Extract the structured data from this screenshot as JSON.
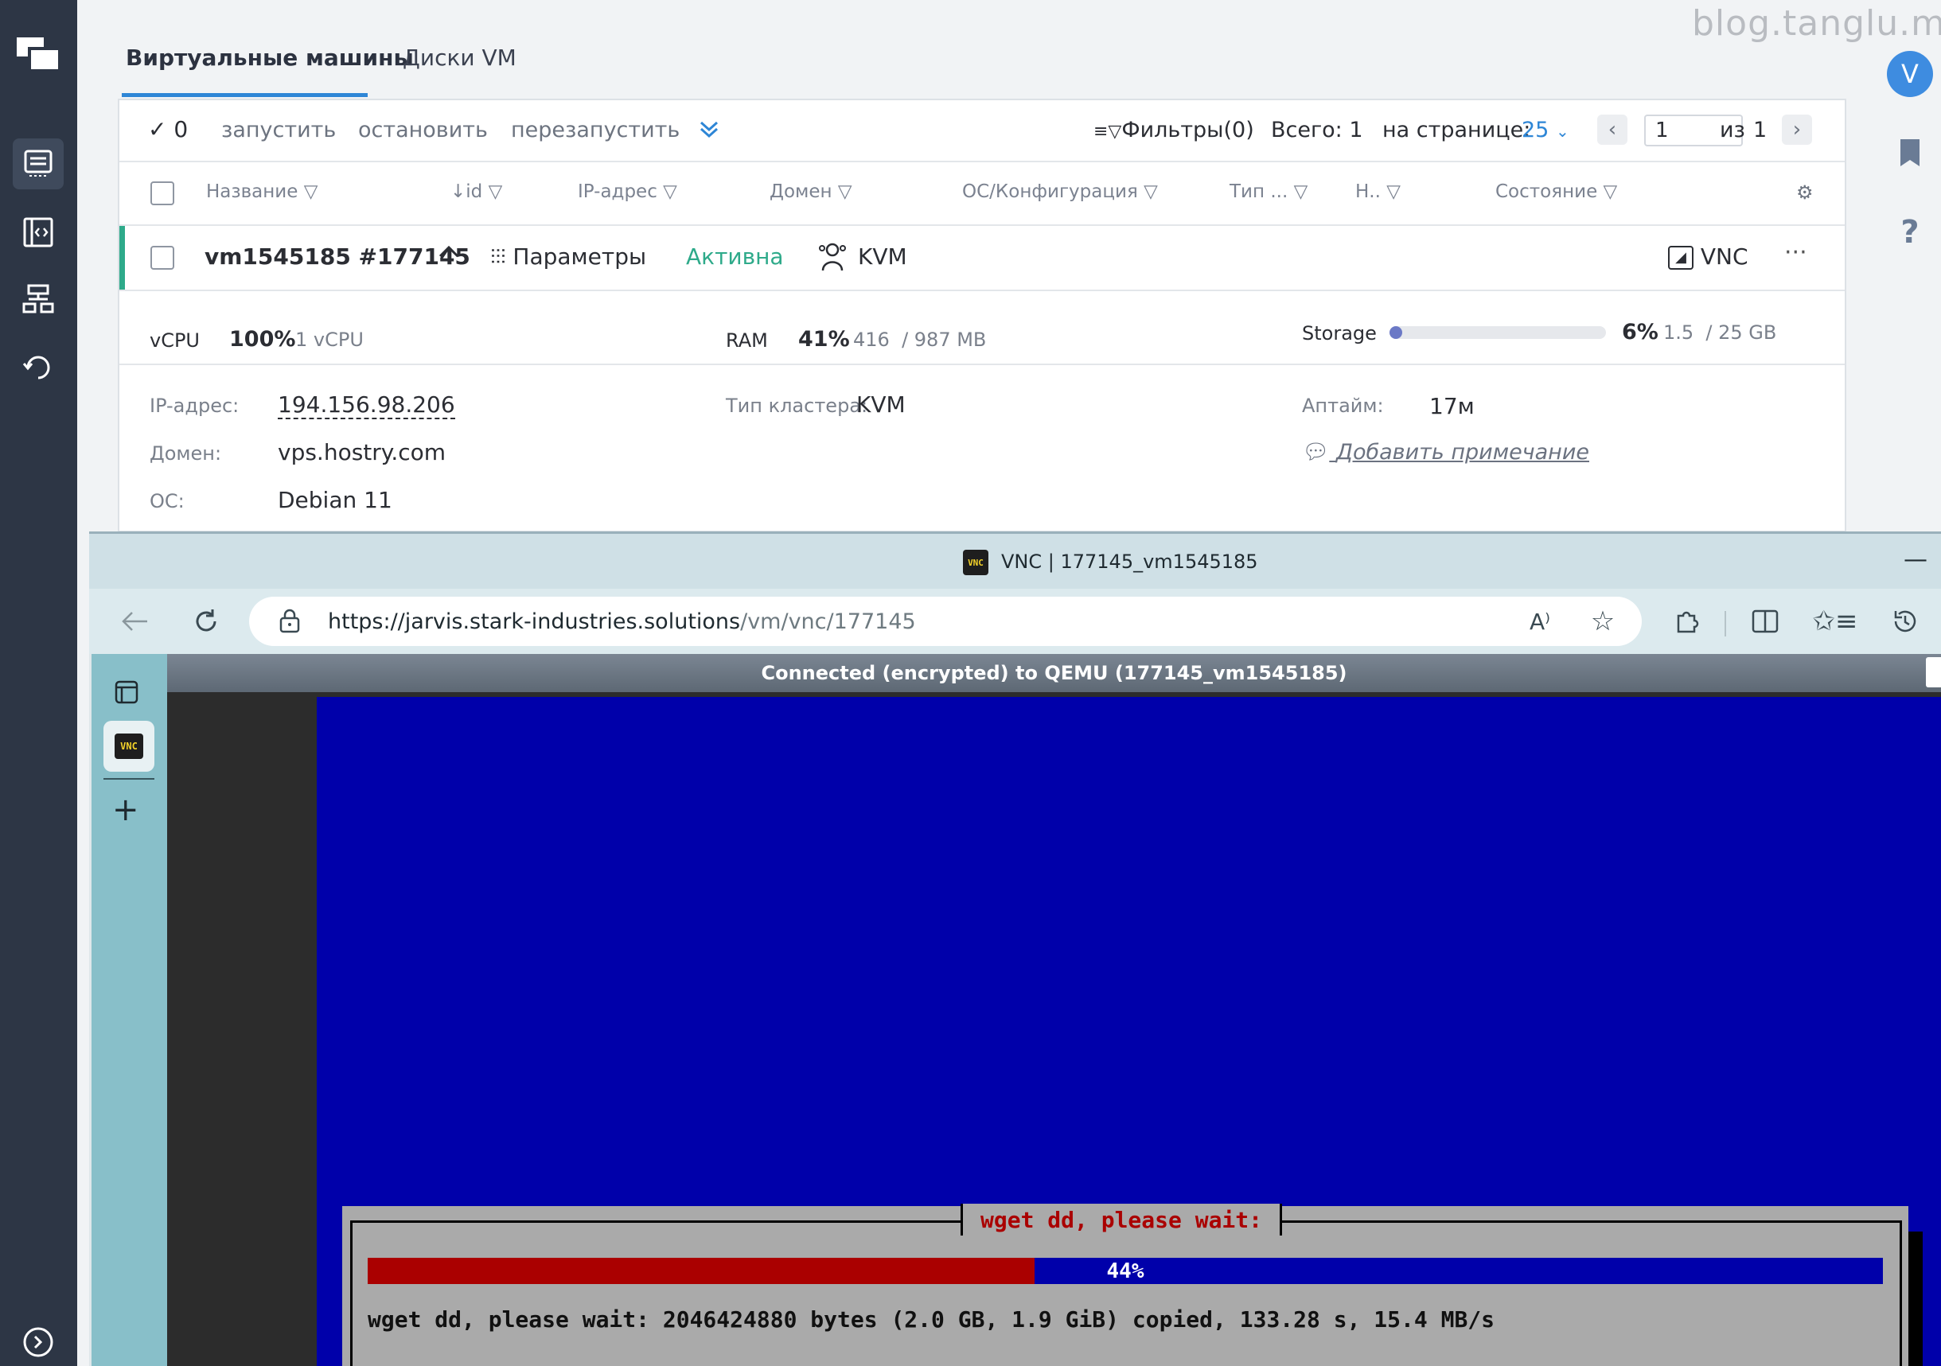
{
  "watermark": "blog.tanglu.me",
  "avatar_letter": "V",
  "tabs": [
    {
      "label": "Виртуальные машины"
    },
    {
      "label": "Диски VM"
    }
  ],
  "toolbar": {
    "selected_count": "0",
    "start": "запустить",
    "stop": "остановить",
    "restart": "перезапустить",
    "filters": "Фильтры(0)",
    "total": "Всего: 1",
    "per_page_label": "на странице:",
    "per_page_value": "25",
    "page_input": "1",
    "of_label": "из",
    "page_total": "1"
  },
  "columns": {
    "name": "Название",
    "id": "↓id",
    "ip": "IP-адрес",
    "domain": "Домен",
    "os": "ОС/Конфигурация",
    "type": "Тип ...",
    "n": "Н..",
    "state": "Состояние"
  },
  "vm": {
    "name": "vm1545185 #177145",
    "params": "Параметры",
    "status": "Активна",
    "hypervisor": "KVM",
    "vnc": "VNC",
    "vcpu_label": "vCPU",
    "vcpu_pct": "100%",
    "vcpu_detail": "1 vCPU",
    "ram_label": "RAM",
    "ram_pct": "41%",
    "ram_detail": "416  / 987 MB",
    "storage_label": "Storage",
    "storage_pct": "6%",
    "storage_fraction": 0.06,
    "storage_detail": "1.5  / 25 GB",
    "ip_label": "IP-адрес:",
    "ip_value": "194.156.98.206",
    "cluster_label": "Тип кластера:",
    "cluster_value": "KVM",
    "uptime_label": "Аптайм:",
    "uptime_value": "17м",
    "domain_label": "Домен:",
    "domain_value": "vps.hostry.com",
    "add_note": "Добавить примечание",
    "os_label": "ОС:",
    "os_value": "Debian 11"
  },
  "browser": {
    "title": "VNC | 177145_vm1545185",
    "url_host": "https://jarvis.stark-industries.solutions",
    "url_path": "/vm/vnc/177145",
    "vnc_badge": "VNC"
  },
  "vnc": {
    "status": "Connected (encrypted) to QEMU (177145_vm1545185)",
    "dialog_title": "wget dd, please wait:",
    "progress_label": "44%",
    "progress_fraction": 0.44,
    "dd_line": "wget dd, please wait: 2046424880 bytes (2.0 GB, 1.9 GiB) copied, 133.28 s, 15.4 MB/s"
  },
  "colors": {
    "accent": "#2e86d6",
    "active_status": "#2eaa8a",
    "sidebar": "#2d3645",
    "qemu_blue": "#0000aa",
    "qemu_red": "#aa0000"
  }
}
